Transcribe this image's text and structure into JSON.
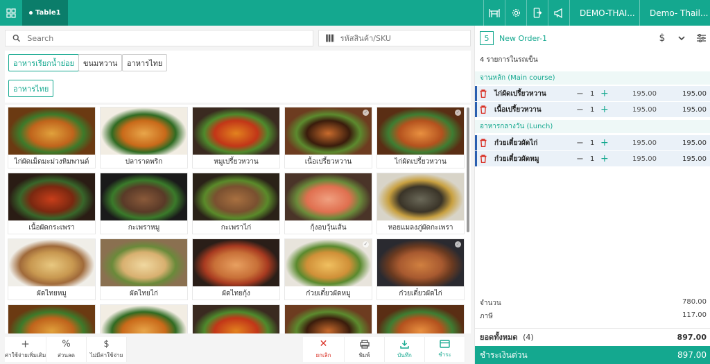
{
  "topbar": {
    "table_tab": "Table1",
    "store_label": "DEMO-THAI...",
    "user_label": "Demo- Thail...",
    "icons": [
      "grid-icon",
      "table-icon",
      "gear-icon",
      "phone-exit-icon",
      "megaphone-icon",
      "store-icon",
      "user-icon"
    ]
  },
  "search": {
    "placeholder": "Search",
    "sku_placeholder": "รหัสสินค้า/SKU"
  },
  "categories": {
    "row1": [
      "อาหารเรียกน้ำย่อย",
      "ขนมหวาน",
      "อาหารไทย"
    ],
    "row2": [
      "อาหารไทย"
    ]
  },
  "products": [
    {
      "name": "ไก่ผัดเม็ดมะม่วงหิมพานต์",
      "checked": false
    },
    {
      "name": "ปลาราดพริก",
      "checked": false
    },
    {
      "name": "หมูเปรี้ยวหวาน",
      "checked": false
    },
    {
      "name": "เนื้อเปรี้ยวหวาน",
      "checked": true
    },
    {
      "name": "ไก่ผัดเปรี้ยวหวาน",
      "checked": true
    },
    {
      "name": "เนื้อผัดกระเพรา",
      "checked": false
    },
    {
      "name": "กะเพราหมู",
      "checked": false
    },
    {
      "name": "กะเพราไก่",
      "checked": false
    },
    {
      "name": "กุ้งอบวุ้นเส้น",
      "checked": false
    },
    {
      "name": "หอยแมลงภู่ผัดกะเพรา",
      "checked": false
    },
    {
      "name": "ผัดไทยหมู",
      "checked": false
    },
    {
      "name": "ผัดไทยไก่",
      "checked": false
    },
    {
      "name": "ผัดไทยกุ้ง",
      "checked": false
    },
    {
      "name": "ก๋วยเตี๋ยวผัดหมู",
      "checked": true
    },
    {
      "name": "ก๋วยเตี๋ยวผัดไก่",
      "checked": true
    },
    {
      "name": "",
      "checked": false
    },
    {
      "name": "",
      "checked": false
    },
    {
      "name": "",
      "checked": false
    },
    {
      "name": "",
      "checked": false
    },
    {
      "name": "",
      "checked": false
    }
  ],
  "bottom_actions": {
    "left": [
      {
        "label": "ค่าใช้จ่ายเพิ่มเติม",
        "icon": "plus-icon"
      },
      {
        "label": "ส่วนลด",
        "icon": "percent-icon"
      },
      {
        "label": "ไม่มีค่าใช้จ่าย",
        "icon": "no-charge-icon"
      }
    ],
    "right": [
      {
        "label": "ยกเลิก",
        "icon": "close-icon",
        "color": "#d93025"
      },
      {
        "label": "พิมพ์",
        "icon": "printer-icon",
        "color": "#555555"
      },
      {
        "label": "บันทึก",
        "icon": "download-icon",
        "color": "#14a88f"
      },
      {
        "label": "ชำระ",
        "icon": "card-icon",
        "color": "#14a88f"
      }
    ]
  },
  "order": {
    "number": "5",
    "title": "New Order-1",
    "items_count": "4 รายการในรถเข็น",
    "groups": [
      {
        "name": "จานหลัก (Main course)",
        "items": [
          {
            "name": "ไก่ผัดเปรี้ยวหวาน",
            "qty": "1",
            "price": "195.00",
            "total": "195.00"
          },
          {
            "name": "เนื้อเปรี้ยวหวาน",
            "qty": "1",
            "price": "195.00",
            "total": "195.00"
          }
        ]
      },
      {
        "name": "อาหารกลางวัน (Lunch)",
        "items": [
          {
            "name": "ก๋วยเตี๋ยวผัดไก่",
            "qty": "1",
            "price": "195.00",
            "total": "195.00"
          },
          {
            "name": "ก๋วยเตี๋ยวผัดหมู",
            "qty": "1",
            "price": "195.00",
            "total": "195.00"
          }
        ]
      }
    ],
    "subtotal_label": "จำนวน",
    "subtotal_value": "780.00",
    "tax_label": "ภาษี",
    "tax_value": "117.00",
    "grand_label": "ยอดทั้งหมด",
    "grand_count": "(4)",
    "grand_value": "897.00",
    "pay_label": "ชำระเงินด่วน",
    "pay_value": "897.00"
  },
  "colors": {
    "primary": "#14a88f",
    "primary_dark": "#0b7d6a",
    "danger": "#d93025",
    "selected_line": "#2a5fb0"
  }
}
